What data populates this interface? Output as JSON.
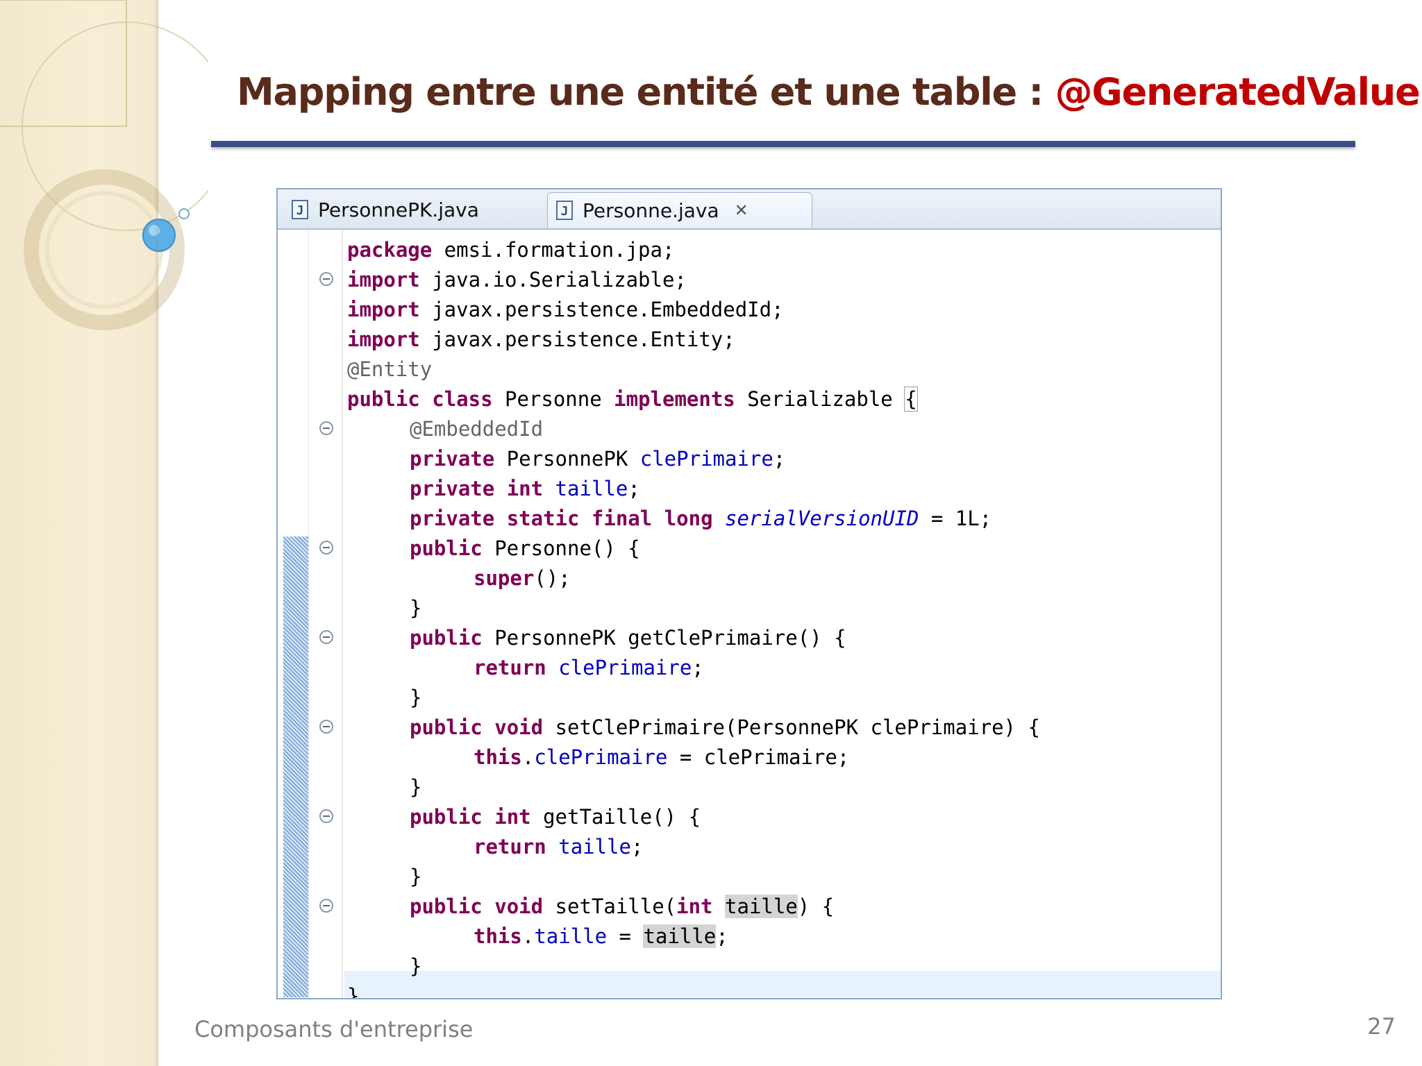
{
  "slide": {
    "title_main": "Mapping entre une entité et une table : ",
    "title_accent": "@GeneratedValue",
    "footer": "Composants d'entreprise",
    "page_number": "27",
    "colors": {
      "title": "#5a2a1a",
      "accent": "#c00000",
      "rule": "#3b4f86"
    }
  },
  "editor": {
    "tabs": [
      {
        "label": "PersonnePK.java",
        "icon": "java-file-icon",
        "active": false
      },
      {
        "label": "Personne.java",
        "icon": "java-file-icon",
        "active": true,
        "close": "close-icon"
      }
    ],
    "code_lines": [
      {
        "text": "package emsi.formation.jpa;",
        "indent": 0,
        "fold": false
      },
      {
        "text": "import java.io.Serializable;",
        "indent": 0,
        "fold": true
      },
      {
        "text": "import javax.persistence.EmbeddedId;",
        "indent": 0,
        "fold": false
      },
      {
        "text": "import javax.persistence.Entity;",
        "indent": 0,
        "fold": false
      },
      {
        "text": "@Entity",
        "indent": 0,
        "fold": false
      },
      {
        "text": "public class Personne implements Serializable {",
        "indent": 0,
        "fold": false
      },
      {
        "text": "@EmbeddedId",
        "indent": 1,
        "fold": true
      },
      {
        "text": "private PersonnePK clePrimaire;",
        "indent": 1,
        "fold": false
      },
      {
        "text": "private int taille;",
        "indent": 1,
        "fold": false
      },
      {
        "text": "private static final long serialVersionUID = 1L;",
        "indent": 1,
        "fold": false
      },
      {
        "text": "public Personne() {",
        "indent": 1,
        "fold": true
      },
      {
        "text": "super();",
        "indent": 2,
        "fold": false
      },
      {
        "text": "}",
        "indent": 1,
        "fold": false
      },
      {
        "text": "public PersonnePK getClePrimaire() {",
        "indent": 1,
        "fold": true
      },
      {
        "text": "return clePrimaire;",
        "indent": 2,
        "fold": false
      },
      {
        "text": "}",
        "indent": 1,
        "fold": false
      },
      {
        "text": "public void setClePrimaire(PersonnePK clePrimaire) {",
        "indent": 1,
        "fold": true
      },
      {
        "text": "this.clePrimaire = clePrimaire;",
        "indent": 2,
        "fold": false
      },
      {
        "text": "}",
        "indent": 1,
        "fold": false
      },
      {
        "text": "public int getTaille() {",
        "indent": 1,
        "fold": true
      },
      {
        "text": "return taille;",
        "indent": 2,
        "fold": false
      },
      {
        "text": "}",
        "indent": 1,
        "fold": false
      },
      {
        "text": "public void setTaille(int taille) {",
        "indent": 1,
        "fold": true
      },
      {
        "text": "this.taille = taille;",
        "indent": 2,
        "fold": false
      },
      {
        "text": "}",
        "indent": 1,
        "fold": false
      },
      {
        "text": "}",
        "indent": 0,
        "fold": false
      }
    ],
    "syntax_colors": {
      "keyword": "#7f0055",
      "annotation": "#646464",
      "field": "#0000c0"
    }
  }
}
